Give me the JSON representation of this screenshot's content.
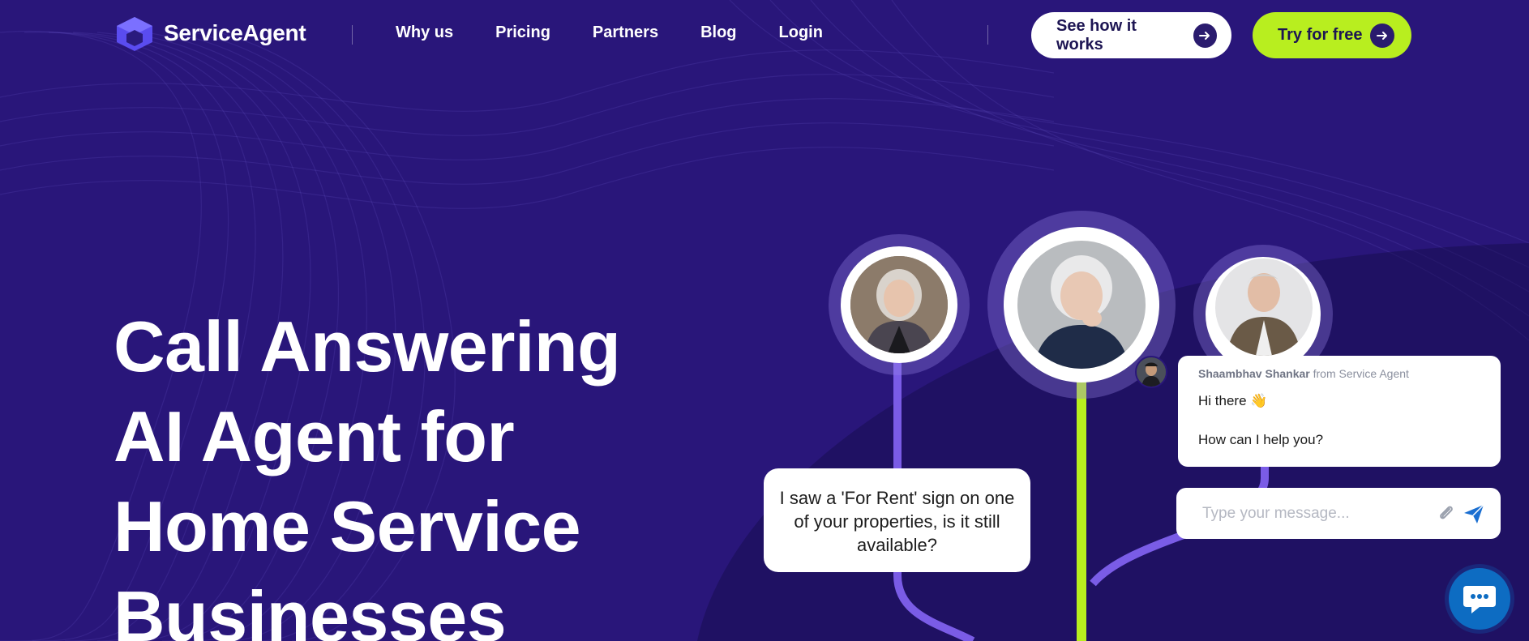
{
  "brand": {
    "name": "ServiceAgent"
  },
  "nav": {
    "links": [
      "Why us",
      "Pricing",
      "Partners",
      "Blog",
      "Login"
    ],
    "cta_secondary": "See how it works",
    "cta_primary": "Try for free"
  },
  "hero": {
    "title_lines": [
      "Call Answering",
      "AI Agent for",
      "Home Service",
      "Businesses"
    ]
  },
  "illustration": {
    "caller_bubble": "I saw a 'For Rent' sign on one of your properties, is it still available?"
  },
  "chat_widget": {
    "agent_name": "Shaambhav Shankar",
    "agent_from": "from Service Agent",
    "greeting": "Hi there 👋",
    "question": "How can I help you?",
    "input_placeholder": "Type your message..."
  },
  "colors": {
    "background": "#29167a",
    "accent_lime": "#b8ee1f",
    "accent_purple": "#7a5ce6",
    "launcher_blue": "#0d6cc2"
  }
}
